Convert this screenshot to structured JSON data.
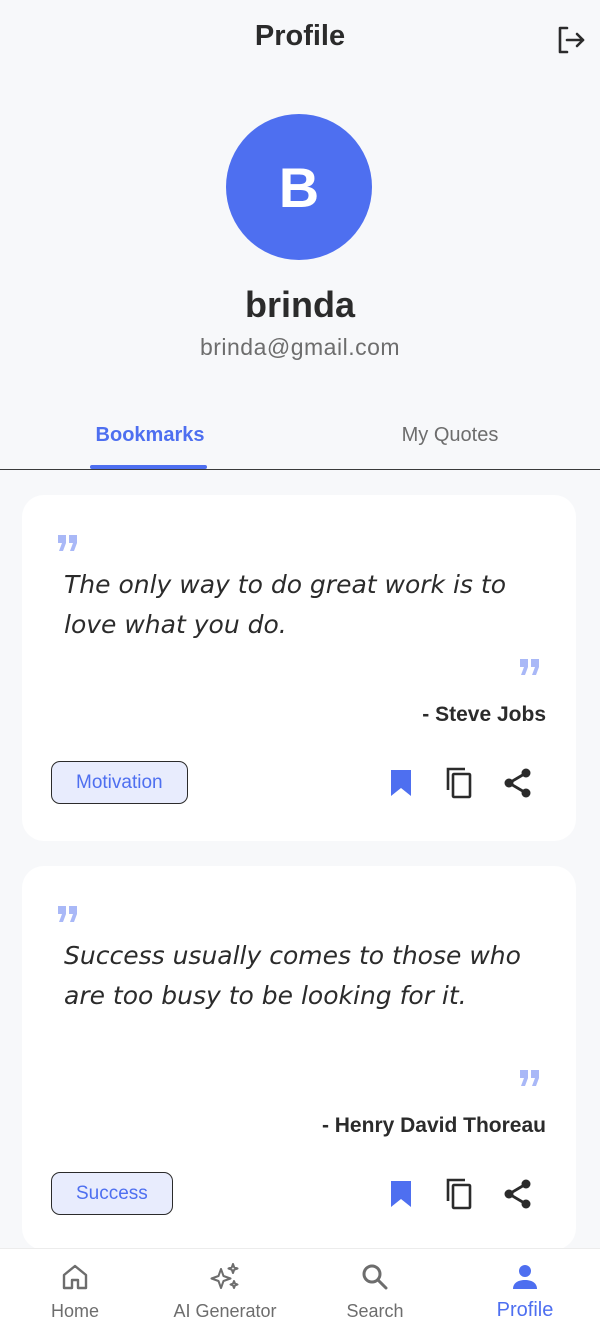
{
  "header": {
    "title": "Profile"
  },
  "profile": {
    "initial": "B",
    "name": "brinda",
    "email": "brinda@gmail.com"
  },
  "tabs": [
    {
      "label": "Bookmarks",
      "active": true
    },
    {
      "label": "My Quotes",
      "active": false
    }
  ],
  "quotes": [
    {
      "text": "The only way to do great work is to love what you do.",
      "author": "- Steve Jobs",
      "tag": "Motivation"
    },
    {
      "text": "Success usually comes to those who are too busy to be looking for it.",
      "author": "- Henry David Thoreau",
      "tag": "Success"
    }
  ],
  "nav": [
    {
      "label": "Home",
      "icon": "home-icon",
      "active": false
    },
    {
      "label": "AI Generator",
      "icon": "sparkle-icon",
      "active": false
    },
    {
      "label": "Search",
      "icon": "search-icon",
      "active": false
    },
    {
      "label": "Profile",
      "icon": "person-icon",
      "active": true
    }
  ],
  "colors": {
    "accent": "#4e6ff0",
    "quote_mark": "#a9b8f7",
    "tag_bg": "#e8ecfd"
  }
}
